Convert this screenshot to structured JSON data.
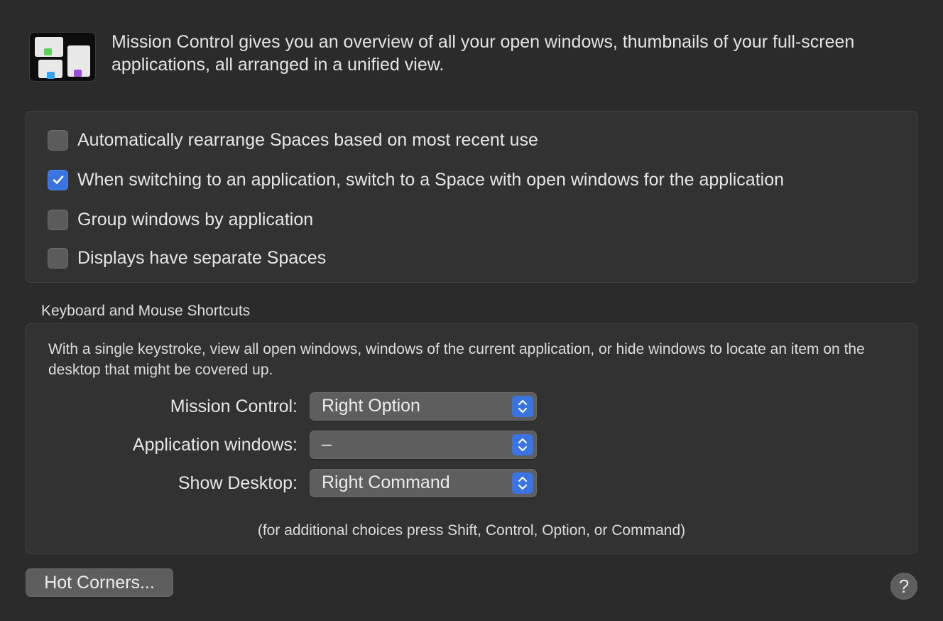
{
  "intro": {
    "text": "Mission Control gives you an overview of all your open windows, thumbnails of your full-screen applications, all arranged in a unified view."
  },
  "options": [
    {
      "label": "Automatically rearrange Spaces based on most recent use",
      "checked": false
    },
    {
      "label": "When switching to an application, switch to a Space with open windows for the application",
      "checked": true
    },
    {
      "label": "Group windows by application",
      "checked": false
    },
    {
      "label": "Displays have separate Spaces",
      "checked": false
    }
  ],
  "shortcuts": {
    "section_title": "Keyboard and Mouse Shortcuts",
    "description": "With a single keystroke, view all open windows, windows of the current application, or hide windows to locate an item on the desktop that might be covered up.",
    "rows": [
      {
        "label": "Mission Control:",
        "value": "Right Option"
      },
      {
        "label": "Application windows:",
        "value": "–"
      },
      {
        "label": "Show Desktop:",
        "value": "Right Command"
      }
    ],
    "hint": "(for additional choices press Shift, Control, Option, or Command)"
  },
  "buttons": {
    "hot_corners": "Hot Corners...",
    "help": "?"
  },
  "colors": {
    "background": "#2b2b2b",
    "accent": "#3a74e0",
    "icon_green": "#5dd35d",
    "icon_blue": "#3aa0f0",
    "icon_purple": "#9a4fe0"
  },
  "icons": {
    "app": "mission-control-icon",
    "checkmark": "checkmark-icon",
    "popup_arrows": "up-down-chevron-icon",
    "help": "question-mark-icon"
  }
}
